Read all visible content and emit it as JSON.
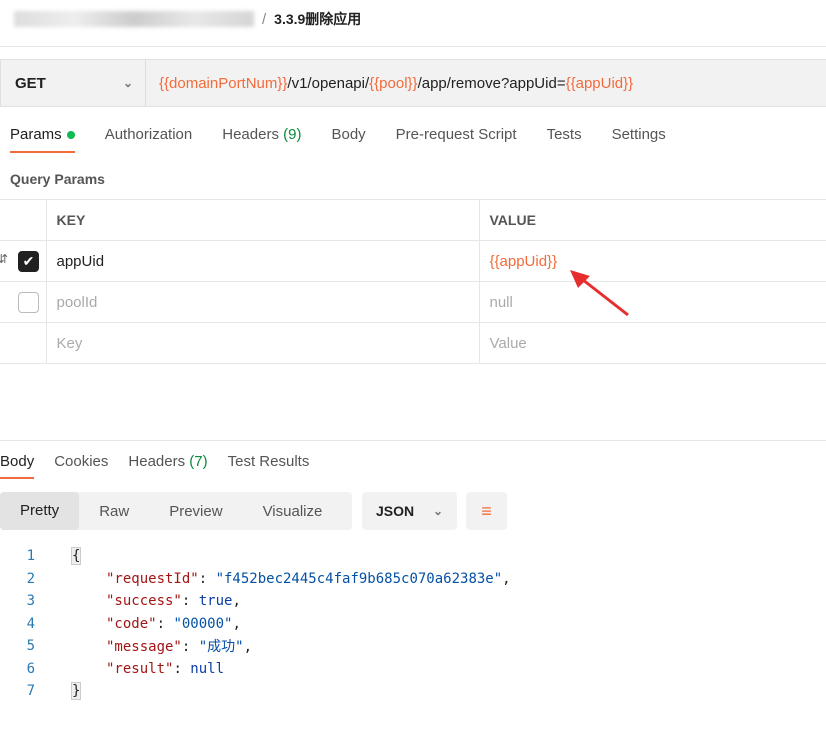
{
  "breadcrumb": {
    "current": "3.3.9删除应用",
    "separator": "/"
  },
  "request": {
    "method": "GET",
    "url_parts": [
      {
        "t": "{{domainPortNum}}",
        "var": true
      },
      {
        "t": "/v1/openapi/",
        "var": false
      },
      {
        "t": "{{pool}}",
        "var": true
      },
      {
        "t": "/app/remove?appUid=",
        "var": false
      },
      {
        "t": "{{appUid}}",
        "var": true
      }
    ]
  },
  "tabs": {
    "params": "Params",
    "authorization": "Authorization",
    "headers": "Headers",
    "headers_count": "(9)",
    "body": "Body",
    "prerequest": "Pre-request Script",
    "tests": "Tests",
    "settings": "Settings"
  },
  "query_params": {
    "title": "Query Params",
    "key_header": "KEY",
    "value_header": "VALUE",
    "rows": [
      {
        "key": "appUid",
        "value": "{{appUid}}",
        "checked": true
      },
      {
        "key": "poolId",
        "value": "null",
        "checked": false
      }
    ],
    "key_placeholder": "Key",
    "value_placeholder": "Value"
  },
  "response": {
    "tabs": {
      "body": "Body",
      "cookies": "Cookies",
      "headers": "Headers",
      "headers_count": "(7)",
      "tests": "Test Results"
    },
    "modes": [
      "Pretty",
      "Raw",
      "Preview",
      "Visualize"
    ],
    "format": "JSON",
    "lines": [
      "1",
      "2",
      "3",
      "4",
      "5",
      "6",
      "7"
    ],
    "json": {
      "requestId_key": "\"requestId\"",
      "requestId": "\"f452bec2445c4faf9b685c070a62383e\"",
      "success_key": "\"success\"",
      "success": "true",
      "code_key": "\"code\"",
      "code": "\"00000\"",
      "message_key": "\"message\"",
      "message": "\"成功\"",
      "result_key": "\"result\"",
      "result": "null",
      "open": "{",
      "close": "}"
    }
  }
}
